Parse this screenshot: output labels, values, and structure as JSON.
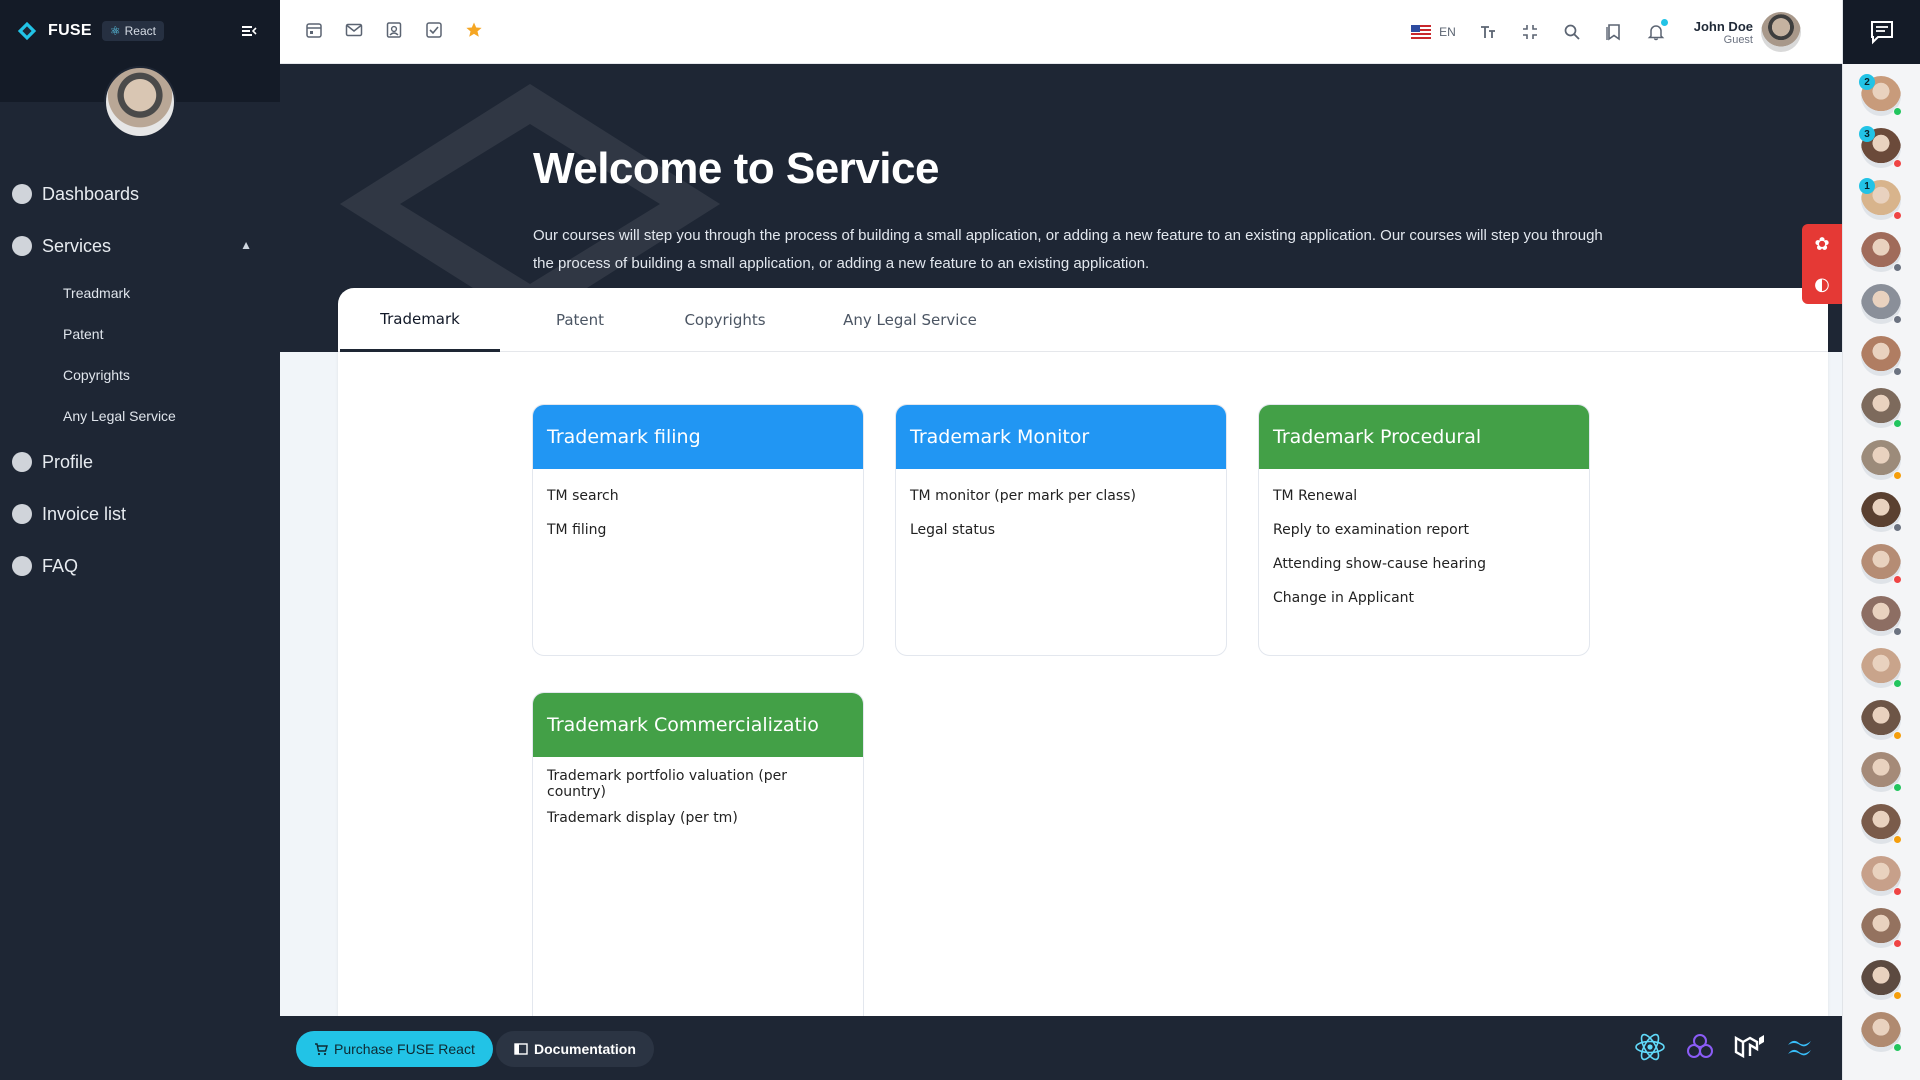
{
  "app": {
    "brand": "FUSE",
    "badge": "React"
  },
  "nav": {
    "items": [
      {
        "label": "Dashboards"
      },
      {
        "label": "Services",
        "expanded": true,
        "children": [
          "Treadmark",
          "Patent",
          "Copyrights",
          "Any Legal Service"
        ]
      },
      {
        "label": "Profile"
      },
      {
        "label": "Invoice list"
      },
      {
        "label": "FAQ"
      }
    ]
  },
  "toolbar": {
    "shortcuts": [
      "calendar-icon",
      "mail-icon",
      "contacts-icon",
      "tasks-icon",
      "star-icon"
    ],
    "language": "EN",
    "user": {
      "name": "John Doe",
      "role": "Guest"
    }
  },
  "hero": {
    "title": "Welcome to Service",
    "description": "Our courses will step you through the process of building a small application, or adding a new feature to an existing application. Our courses will step you through the process of building a small application, or adding a new feature to an existing application."
  },
  "tabs": [
    "Trademark",
    "Patent",
    "Copyrights",
    "Any Legal Service"
  ],
  "active_tab": "Trademark",
  "cards": [
    {
      "title": "Trademark filing",
      "color": "#2196f3",
      "items": [
        "TM search",
        "TM filing"
      ]
    },
    {
      "title": "Trademark Monitor",
      "color": "#2196f3",
      "items": [
        "TM monitor (per mark per class)",
        "Legal status"
      ]
    },
    {
      "title": "Trademark Procedural",
      "color": "#43a047",
      "items": [
        "TM Renewal",
        "Reply to examination report",
        "Attending show-cause hearing",
        "Change in Applicant"
      ]
    },
    {
      "title": "Trademark Commercializatio",
      "color": "#43a047",
      "items": [
        "Trademark portfolio valuation (per country)",
        "Trademark display (per tm)"
      ]
    }
  ],
  "footer": {
    "purchase_label": "Purchase FUSE React",
    "docs_label": "Documentation",
    "tech_icons": [
      "react-icon",
      "redux-icon",
      "mui-icon",
      "tailwind-icon"
    ]
  },
  "chat": {
    "contacts": [
      {
        "status": "#22c55e",
        "unread": "2"
      },
      {
        "status": "#ef4444",
        "unread": "3"
      },
      {
        "status": "#ef4444",
        "unread": "1"
      },
      {
        "status": "#6b7280"
      },
      {
        "status": "#6b7280"
      },
      {
        "status": "#6b7280"
      },
      {
        "status": "#22c55e"
      },
      {
        "status": "#f59e0b"
      },
      {
        "status": "#6b7280"
      },
      {
        "status": "#ef4444"
      },
      {
        "status": "#6b7280"
      },
      {
        "status": "#22c55e"
      },
      {
        "status": "#f59e0b"
      },
      {
        "status": "#22c55e"
      },
      {
        "status": "#f59e0b"
      },
      {
        "status": "#ef4444"
      },
      {
        "status": "#ef4444"
      },
      {
        "status": "#f59e0b"
      },
      {
        "status": "#22c55e"
      }
    ]
  },
  "colors": {
    "accent": "#22c3e6",
    "blue": "#2196f3",
    "green": "#43a047",
    "dark": "#1e2634"
  }
}
